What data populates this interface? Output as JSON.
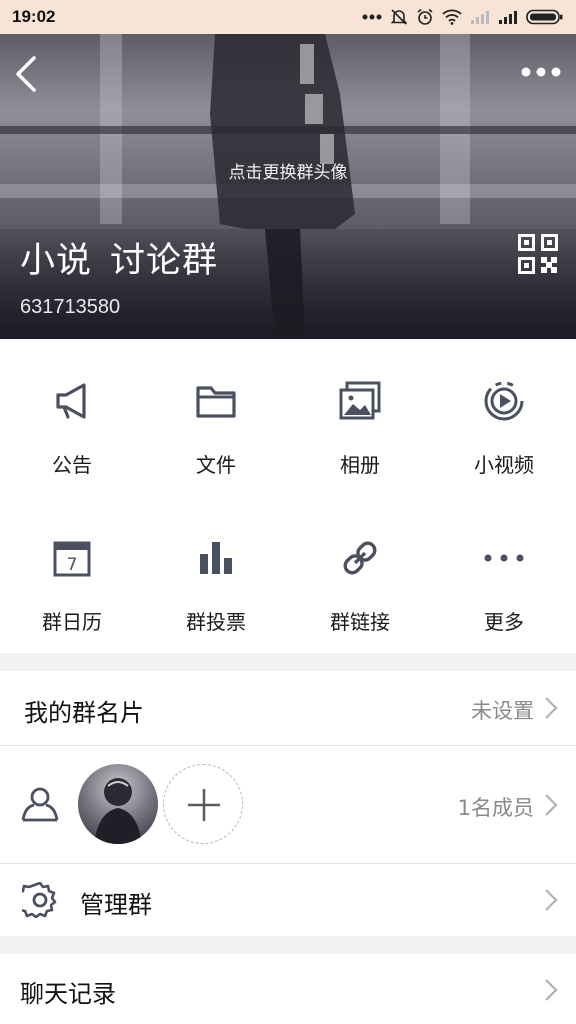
{
  "status_bar": {
    "time": "19:02",
    "icons": [
      "more-dots-icon",
      "mute-icon",
      "alarm-icon",
      "wifi-icon",
      "signal-icon",
      "signal-icon",
      "battery-icon"
    ]
  },
  "header": {
    "change_avatar_hint": "点击更换群头像",
    "group_name_part1": "小说",
    "group_name_part2": "讨论群",
    "group_id": "631713580"
  },
  "features": [
    {
      "label": "公告",
      "icon": "megaphone-icon"
    },
    {
      "label": "文件",
      "icon": "folder-icon"
    },
    {
      "label": "相册",
      "icon": "photo-album-icon"
    },
    {
      "label": "小视频",
      "icon": "video-icon"
    },
    {
      "label": "群日历",
      "icon": "calendar-icon"
    },
    {
      "label": "群投票",
      "icon": "bar-chart-icon"
    },
    {
      "label": "群链接",
      "icon": "link-icon"
    },
    {
      "label": "更多",
      "icon": "more-dots-icon"
    }
  ],
  "calendar_day": "7",
  "rows": {
    "card": {
      "label": "我的群名片",
      "value": "未设置"
    },
    "members": {
      "value": "1名成员"
    },
    "manage": {
      "label": "管理群"
    },
    "chat_history": {
      "label": "聊天记录"
    }
  },
  "colors": {
    "icon": "#4a5060",
    "background": "#f2f2f4",
    "status_bar": "#f7e4d6"
  }
}
